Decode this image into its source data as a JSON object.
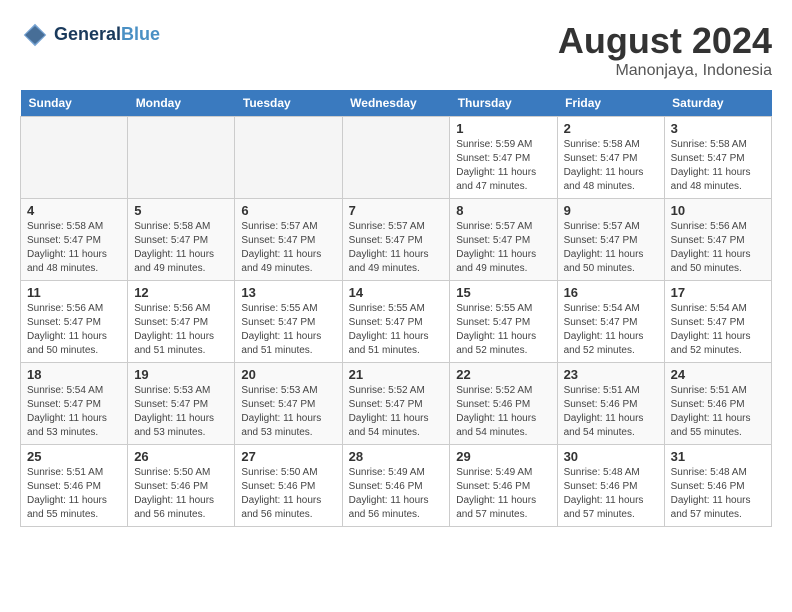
{
  "header": {
    "logo_line1": "General",
    "logo_line2": "Blue",
    "month_year": "August 2024",
    "location": "Manonjaya, Indonesia"
  },
  "days_of_week": [
    "Sunday",
    "Monday",
    "Tuesday",
    "Wednesday",
    "Thursday",
    "Friday",
    "Saturday"
  ],
  "weeks": [
    [
      {
        "day": "",
        "info": ""
      },
      {
        "day": "",
        "info": ""
      },
      {
        "day": "",
        "info": ""
      },
      {
        "day": "",
        "info": ""
      },
      {
        "day": "1",
        "info": "Sunrise: 5:59 AM\nSunset: 5:47 PM\nDaylight: 11 hours and 47 minutes."
      },
      {
        "day": "2",
        "info": "Sunrise: 5:58 AM\nSunset: 5:47 PM\nDaylight: 11 hours and 48 minutes."
      },
      {
        "day": "3",
        "info": "Sunrise: 5:58 AM\nSunset: 5:47 PM\nDaylight: 11 hours and 48 minutes."
      }
    ],
    [
      {
        "day": "4",
        "info": "Sunrise: 5:58 AM\nSunset: 5:47 PM\nDaylight: 11 hours and 48 minutes."
      },
      {
        "day": "5",
        "info": "Sunrise: 5:58 AM\nSunset: 5:47 PM\nDaylight: 11 hours and 49 minutes."
      },
      {
        "day": "6",
        "info": "Sunrise: 5:57 AM\nSunset: 5:47 PM\nDaylight: 11 hours and 49 minutes."
      },
      {
        "day": "7",
        "info": "Sunrise: 5:57 AM\nSunset: 5:47 PM\nDaylight: 11 hours and 49 minutes."
      },
      {
        "day": "8",
        "info": "Sunrise: 5:57 AM\nSunset: 5:47 PM\nDaylight: 11 hours and 49 minutes."
      },
      {
        "day": "9",
        "info": "Sunrise: 5:57 AM\nSunset: 5:47 PM\nDaylight: 11 hours and 50 minutes."
      },
      {
        "day": "10",
        "info": "Sunrise: 5:56 AM\nSunset: 5:47 PM\nDaylight: 11 hours and 50 minutes."
      }
    ],
    [
      {
        "day": "11",
        "info": "Sunrise: 5:56 AM\nSunset: 5:47 PM\nDaylight: 11 hours and 50 minutes."
      },
      {
        "day": "12",
        "info": "Sunrise: 5:56 AM\nSunset: 5:47 PM\nDaylight: 11 hours and 51 minutes."
      },
      {
        "day": "13",
        "info": "Sunrise: 5:55 AM\nSunset: 5:47 PM\nDaylight: 11 hours and 51 minutes."
      },
      {
        "day": "14",
        "info": "Sunrise: 5:55 AM\nSunset: 5:47 PM\nDaylight: 11 hours and 51 minutes."
      },
      {
        "day": "15",
        "info": "Sunrise: 5:55 AM\nSunset: 5:47 PM\nDaylight: 11 hours and 52 minutes."
      },
      {
        "day": "16",
        "info": "Sunrise: 5:54 AM\nSunset: 5:47 PM\nDaylight: 11 hours and 52 minutes."
      },
      {
        "day": "17",
        "info": "Sunrise: 5:54 AM\nSunset: 5:47 PM\nDaylight: 11 hours and 52 minutes."
      }
    ],
    [
      {
        "day": "18",
        "info": "Sunrise: 5:54 AM\nSunset: 5:47 PM\nDaylight: 11 hours and 53 minutes."
      },
      {
        "day": "19",
        "info": "Sunrise: 5:53 AM\nSunset: 5:47 PM\nDaylight: 11 hours and 53 minutes."
      },
      {
        "day": "20",
        "info": "Sunrise: 5:53 AM\nSunset: 5:47 PM\nDaylight: 11 hours and 53 minutes."
      },
      {
        "day": "21",
        "info": "Sunrise: 5:52 AM\nSunset: 5:47 PM\nDaylight: 11 hours and 54 minutes."
      },
      {
        "day": "22",
        "info": "Sunrise: 5:52 AM\nSunset: 5:46 PM\nDaylight: 11 hours and 54 minutes."
      },
      {
        "day": "23",
        "info": "Sunrise: 5:51 AM\nSunset: 5:46 PM\nDaylight: 11 hours and 54 minutes."
      },
      {
        "day": "24",
        "info": "Sunrise: 5:51 AM\nSunset: 5:46 PM\nDaylight: 11 hours and 55 minutes."
      }
    ],
    [
      {
        "day": "25",
        "info": "Sunrise: 5:51 AM\nSunset: 5:46 PM\nDaylight: 11 hours and 55 minutes."
      },
      {
        "day": "26",
        "info": "Sunrise: 5:50 AM\nSunset: 5:46 PM\nDaylight: 11 hours and 56 minutes."
      },
      {
        "day": "27",
        "info": "Sunrise: 5:50 AM\nSunset: 5:46 PM\nDaylight: 11 hours and 56 minutes."
      },
      {
        "day": "28",
        "info": "Sunrise: 5:49 AM\nSunset: 5:46 PM\nDaylight: 11 hours and 56 minutes."
      },
      {
        "day": "29",
        "info": "Sunrise: 5:49 AM\nSunset: 5:46 PM\nDaylight: 11 hours and 57 minutes."
      },
      {
        "day": "30",
        "info": "Sunrise: 5:48 AM\nSunset: 5:46 PM\nDaylight: 11 hours and 57 minutes."
      },
      {
        "day": "31",
        "info": "Sunrise: 5:48 AM\nSunset: 5:46 PM\nDaylight: 11 hours and 57 minutes."
      }
    ]
  ]
}
